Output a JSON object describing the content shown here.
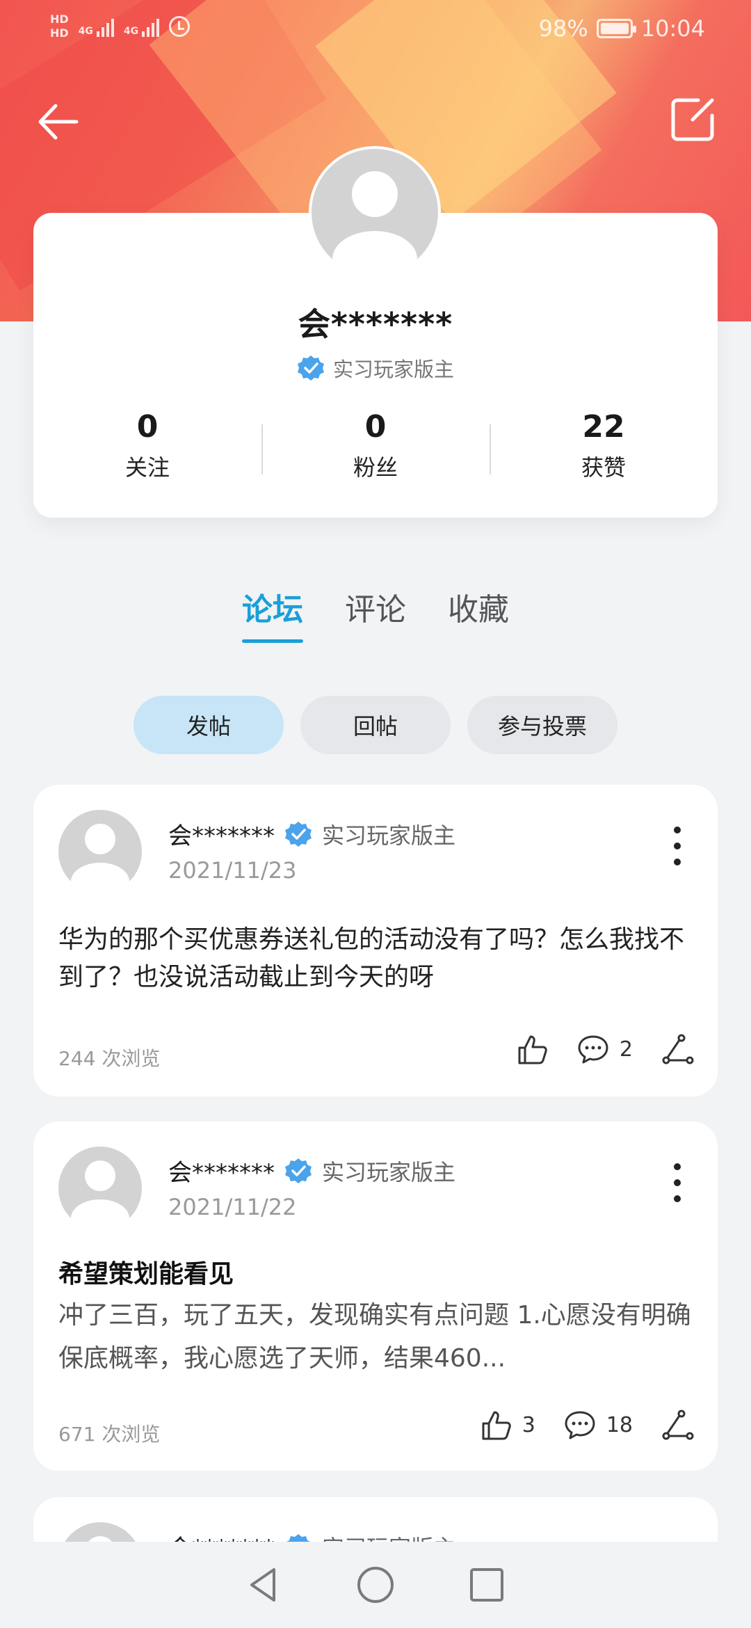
{
  "status_bar": {
    "hd1": "HD",
    "hd2": "HD",
    "net1": "4G",
    "net2": "4G",
    "battery": "98%",
    "time": "10:04"
  },
  "header": {
    "back_icon": "arrow-left-icon",
    "edit_icon": "edit-icon"
  },
  "profile": {
    "name": "会*******",
    "role": "实习玩家版主",
    "stats": [
      {
        "value": "0",
        "label": "关注"
      },
      {
        "value": "0",
        "label": "粉丝"
      },
      {
        "value": "22",
        "label": "获赞"
      }
    ]
  },
  "tabs": [
    {
      "label": "论坛",
      "active": true
    },
    {
      "label": "评论",
      "active": false
    },
    {
      "label": "收藏",
      "active": false
    }
  ],
  "chips": [
    {
      "label": "发帖",
      "active": true
    },
    {
      "label": "回帖",
      "active": false
    },
    {
      "label": "参与投票",
      "active": false
    }
  ],
  "posts": [
    {
      "author": "会*******",
      "role": "实习玩家版主",
      "date": "2021/11/23",
      "text": "华为的那个买优惠券送礼包的活动没有了吗？怎么我找不到了？也没说活动截止到今天的呀",
      "views": "244 次浏览",
      "likes": "",
      "comments": "2"
    },
    {
      "author": "会*******",
      "role": "实习玩家版主",
      "date": "2021/11/22",
      "title": "希望策划能看见",
      "text": "冲了三百，玩了五天，发现确实有点问题 1.心愿没有明确保底概率，我心愿选了天师，结果460...",
      "views": "671 次浏览",
      "likes": "3",
      "comments": "18"
    },
    {
      "author": "会*******",
      "role": "实习玩家版主"
    }
  ],
  "colors": {
    "accent": "#1a9fd8",
    "hero_red": "#f2544f",
    "chip_active": "#c7e5f6"
  }
}
